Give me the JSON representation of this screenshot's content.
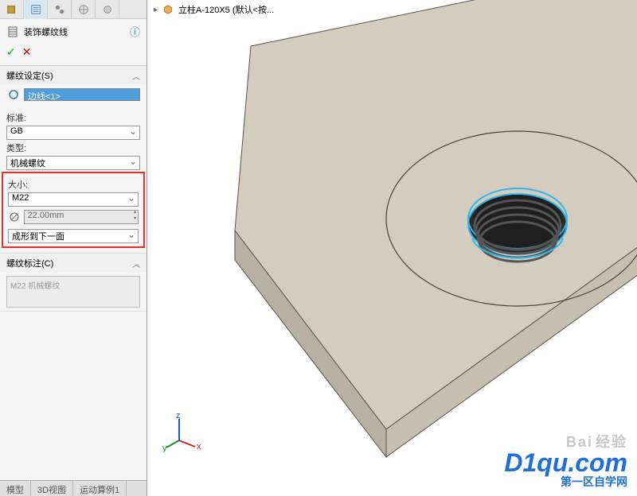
{
  "breadcrumb": {
    "part_name": "立柱A-120X5  (默认<按..."
  },
  "feature": {
    "title": "装饰螺纹线"
  },
  "sections": {
    "settings": {
      "header": "螺纹设定(S)",
      "edge_selection": "边线<1>",
      "standard_label": "标准:",
      "standard_value": "GB",
      "type_label": "类型:",
      "type_value": "机械螺纹",
      "size_label": "大小:",
      "size_value": "M22",
      "diameter_value": "22.00mm",
      "end_condition": "成形到下一面"
    },
    "callout": {
      "header": "螺纹标注(C)",
      "value": "M22 机械螺纹"
    }
  },
  "bottom_tabs": [
    "模型",
    "3D视图",
    "运动算例1"
  ],
  "watermark": {
    "line1": "Bai",
    "line2": "经验",
    "line3": "D1qu.com",
    "line4": "第一区自学网"
  }
}
